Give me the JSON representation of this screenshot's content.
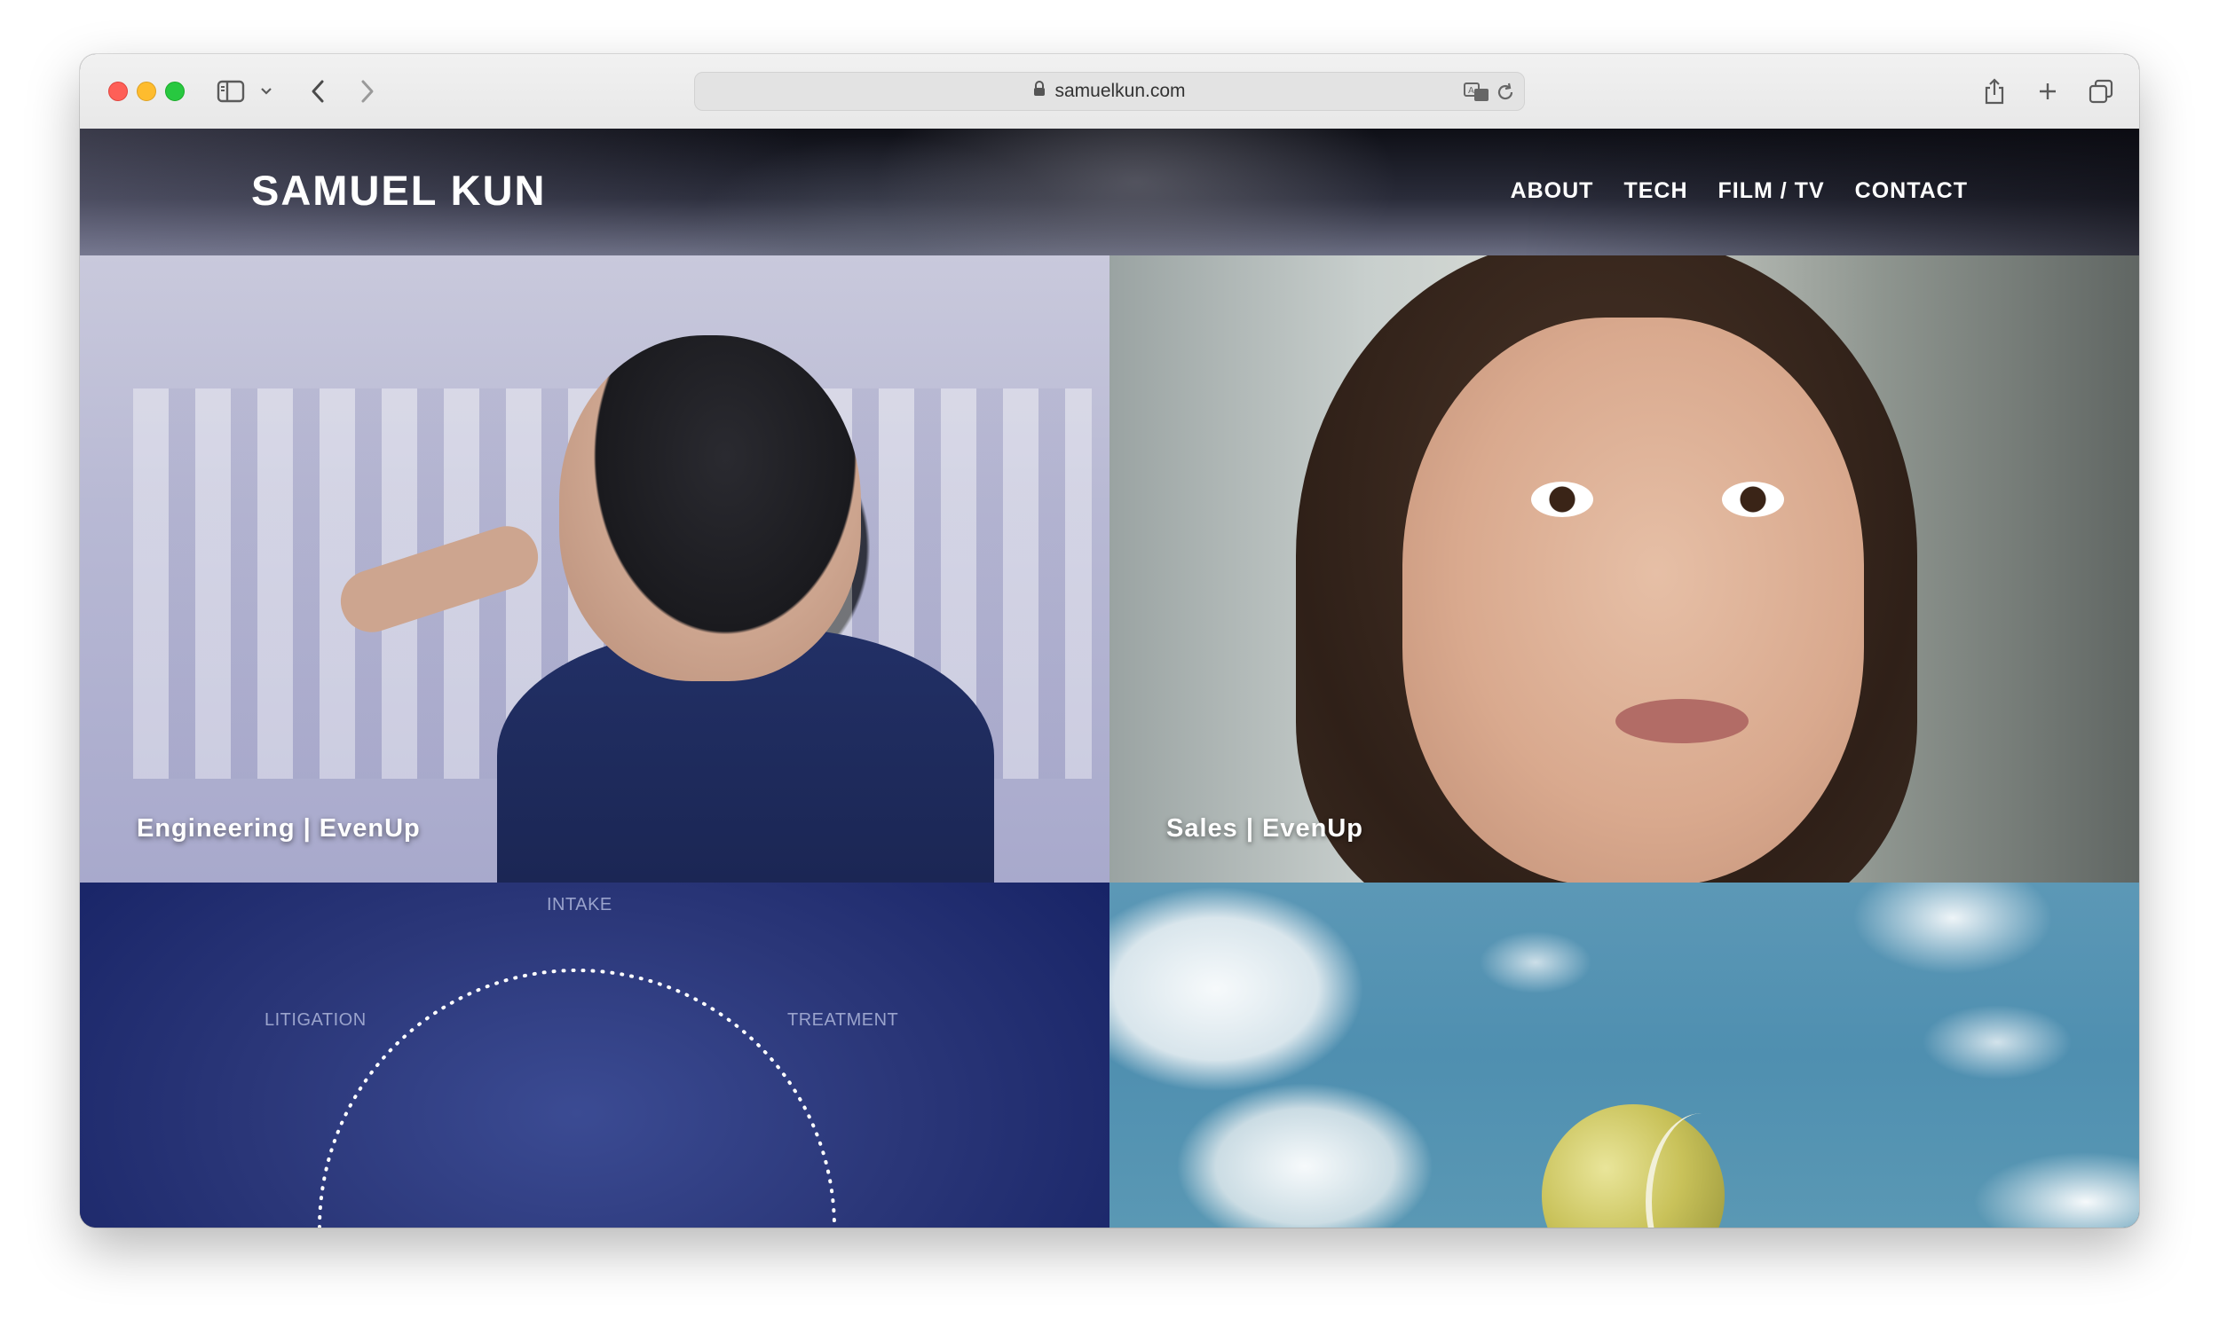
{
  "browser": {
    "url": "samuelkun.com"
  },
  "site": {
    "logo": "SAMUEL KUN",
    "nav": [
      {
        "label": "ABOUT"
      },
      {
        "label": "TECH"
      },
      {
        "label": "FILM / TV"
      },
      {
        "label": "CONTACT"
      }
    ],
    "tiles": [
      {
        "caption": "Engineering | EvenUp"
      },
      {
        "caption": "Sales | EvenUp"
      }
    ],
    "diagram": {
      "labels": [
        "INTAKE",
        "LITIGATION",
        "TREATMENT"
      ]
    }
  },
  "colors": {
    "diagram_bg": "#2b3779",
    "sky": "#5c98b6",
    "ball": "#c9c25a"
  }
}
